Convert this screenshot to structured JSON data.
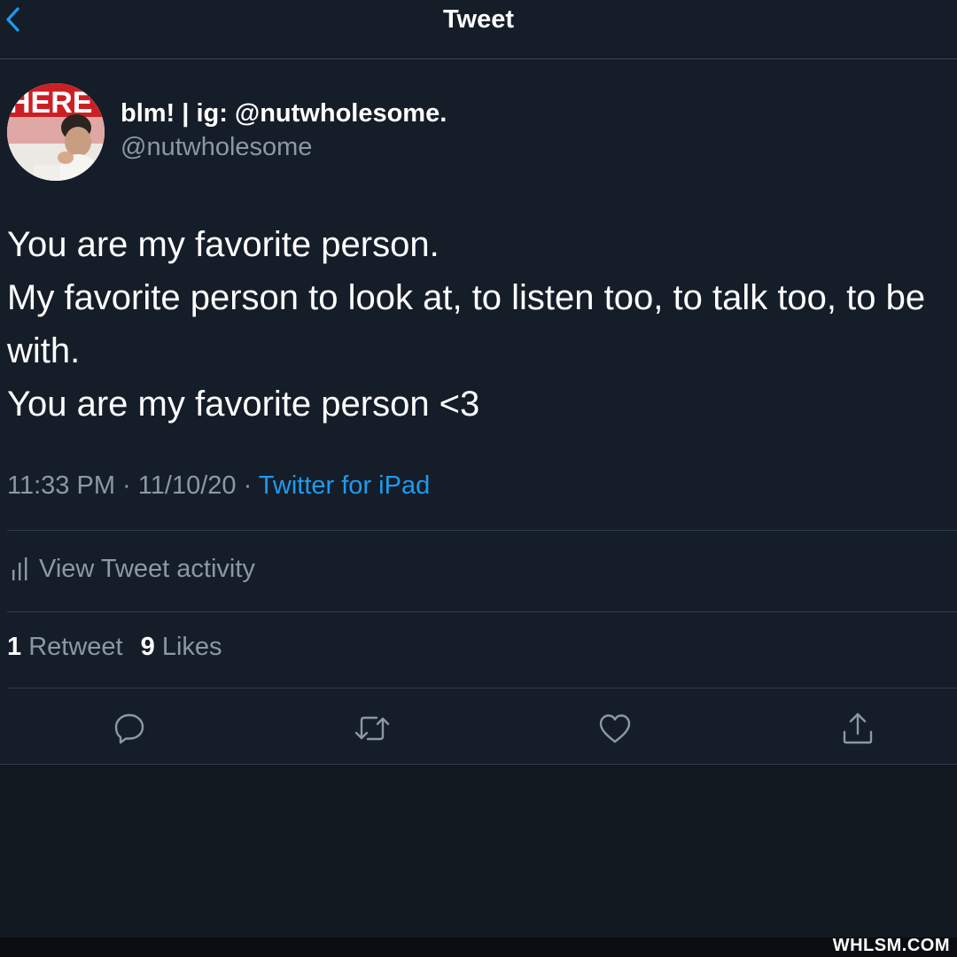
{
  "nav": {
    "title": "Tweet"
  },
  "author": {
    "display_name": "blm! | ig: @nutwholesome.",
    "handle": "@nutwholesome",
    "avatar_sign_text": "HERE"
  },
  "tweet": {
    "lines": [
      "You are my favorite person.",
      "My favorite person to look at, to listen too, to talk too, to be",
      "with.",
      "You are my favorite person <3"
    ],
    "time": "11:33 PM",
    "date": "11/10/20",
    "separator": "·",
    "source": "Twitter for iPad"
  },
  "activity": {
    "label": "View Tweet activity"
  },
  "stats": {
    "retweets_count": "1",
    "retweets_label": "Retweet",
    "likes_count": "9",
    "likes_label": "Likes"
  },
  "actions": {
    "reply_icon": "reply-icon",
    "retweet_icon": "retweet-icon",
    "like_icon": "heart-icon",
    "share_icon": "share-icon"
  },
  "watermark": {
    "text": "WHLSM.COM"
  },
  "colors": {
    "background": "#151d28",
    "accent": "#1d9bf0",
    "secondary_text": "#8a98a6"
  }
}
